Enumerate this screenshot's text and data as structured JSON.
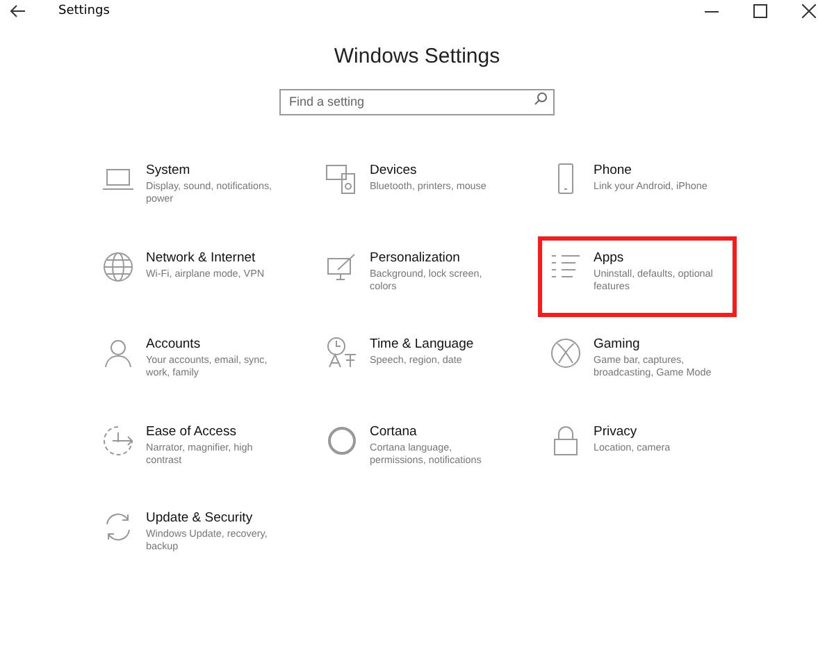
{
  "window": {
    "title": "Settings"
  },
  "heading": "Windows Settings",
  "search": {
    "placeholder": "Find a setting"
  },
  "categories": [
    {
      "title": "System",
      "description": "Display, sound, notifications, power",
      "highlighted": false
    },
    {
      "title": "Devices",
      "description": "Bluetooth, printers, mouse",
      "highlighted": false
    },
    {
      "title": "Phone",
      "description": "Link your Android, iPhone",
      "highlighted": false
    },
    {
      "title": "Network & Internet",
      "description": "Wi-Fi, airplane mode, VPN",
      "highlighted": false
    },
    {
      "title": "Personalization",
      "description": "Background, lock screen, colors",
      "highlighted": false
    },
    {
      "title": "Apps",
      "description": "Uninstall, defaults, optional features",
      "highlighted": true
    },
    {
      "title": "Accounts",
      "description": "Your accounts, email, sync, work, family",
      "highlighted": false
    },
    {
      "title": "Time & Language",
      "description": "Speech, region, date",
      "highlighted": false
    },
    {
      "title": "Gaming",
      "description": "Game bar, captures, broadcasting, Game Mode",
      "highlighted": false
    },
    {
      "title": "Ease of Access",
      "description": "Narrator, magnifier, high contrast",
      "highlighted": false
    },
    {
      "title": "Cortana",
      "description": "Cortana language, permissions, notifications",
      "highlighted": false
    },
    {
      "title": "Privacy",
      "description": "Location, camera",
      "highlighted": false
    },
    {
      "title": "Update & Security",
      "description": "Windows Update, recovery, backup",
      "highlighted": false
    }
  ]
}
